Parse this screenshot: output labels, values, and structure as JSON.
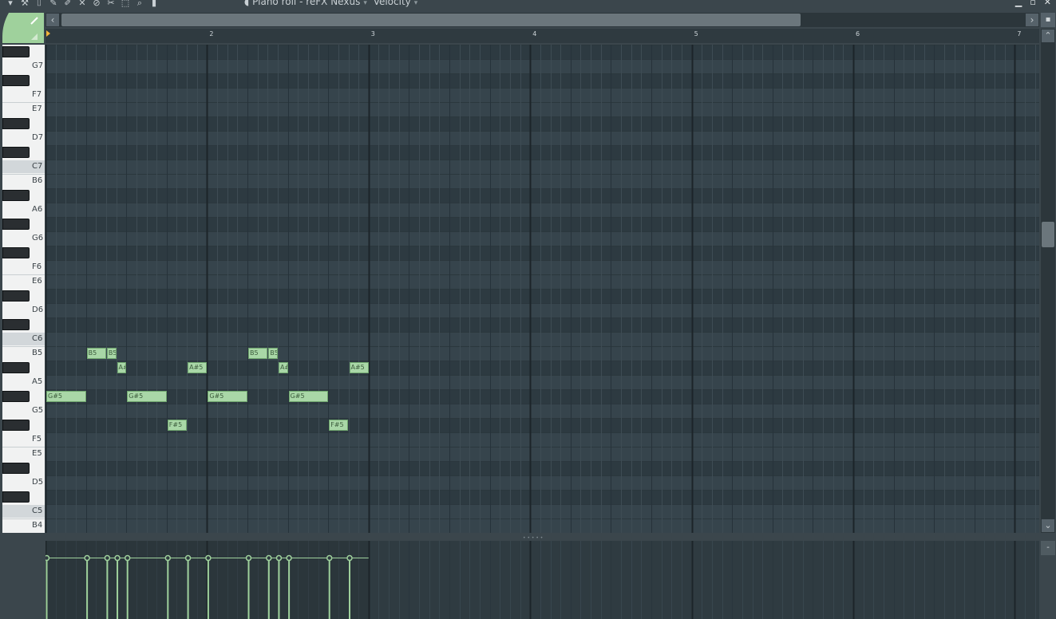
{
  "toolbar": {
    "title": "Piano roll - reFX Nexus",
    "target": "Velocity",
    "tools": [
      "menu-arrow-icon",
      "wrench-icon",
      "stamp-icon",
      "pencil-icon",
      "paint-brush-icon",
      "delete-icon",
      "mute-icon",
      "slice-icon",
      "select-icon",
      "zoom-icon",
      "playback-icon"
    ]
  },
  "ruler": {
    "bars": [
      "2",
      "3",
      "4",
      "5",
      "6",
      "7"
    ]
  },
  "keyboard": {
    "labels": [
      "G7",
      "F7",
      "E7",
      "D7",
      "C7",
      "B6",
      "A6",
      "G6",
      "F6",
      "E6",
      "D6",
      "C6",
      "B5",
      "A5",
      "G5",
      "F5",
      "E5",
      "D5",
      "C5",
      "B4"
    ]
  },
  "notes": [
    {
      "pitch": "G#5",
      "start": 0,
      "length": 1,
      "label": "G#5"
    },
    {
      "pitch": "B5",
      "start": 1,
      "length": 0.5,
      "label": "B5"
    },
    {
      "pitch": "B5",
      "start": 1.5,
      "length": 0.25,
      "label": "B5"
    },
    {
      "pitch": "A#5",
      "start": 1.75,
      "length": 0.25,
      "label": "A#5"
    },
    {
      "pitch": "G#5",
      "start": 2,
      "length": 1,
      "label": "G#5"
    },
    {
      "pitch": "F#5",
      "start": 3,
      "length": 0.5,
      "label": "F#5"
    },
    {
      "pitch": "A#5",
      "start": 3.5,
      "length": 0.5,
      "label": "A#5"
    },
    {
      "pitch": "G#5",
      "start": 4,
      "length": 1,
      "label": "G#5"
    },
    {
      "pitch": "B5",
      "start": 5,
      "length": 0.5,
      "label": "B5"
    },
    {
      "pitch": "B5",
      "start": 5.5,
      "length": 0.25,
      "label": "B5"
    },
    {
      "pitch": "A#5",
      "start": 5.75,
      "length": 0.25,
      "label": "A#5"
    },
    {
      "pitch": "G#5",
      "start": 6,
      "length": 1,
      "label": "G#5"
    },
    {
      "pitch": "F#5",
      "start": 7,
      "length": 0.5,
      "label": "F#5"
    },
    {
      "pitch": "A#5",
      "start": 7.5,
      "length": 0.5,
      "label": "A#5"
    }
  ],
  "velocity": [
    {
      "beat": 0,
      "level": 0.78
    },
    {
      "beat": 1,
      "level": 0.78
    },
    {
      "beat": 1.5,
      "level": 0.78
    },
    {
      "beat": 1.75,
      "level": 0.78
    },
    {
      "beat": 2,
      "level": 0.78
    },
    {
      "beat": 3,
      "level": 0.78
    },
    {
      "beat": 3.5,
      "level": 0.78
    },
    {
      "beat": 4,
      "level": 0.78
    },
    {
      "beat": 5,
      "level": 0.78
    },
    {
      "beat": 5.5,
      "level": 0.78
    },
    {
      "beat": 5.75,
      "level": 0.78
    },
    {
      "beat": 6,
      "level": 0.78
    },
    {
      "beat": 7,
      "level": 0.78
    },
    {
      "beat": 7.5,
      "level": 0.78
    }
  ],
  "colors": {
    "note_fill": "#a9d7a7",
    "note_border": "#6fa56e",
    "marker": "#f2b33a",
    "accent": "#9fd19c"
  }
}
